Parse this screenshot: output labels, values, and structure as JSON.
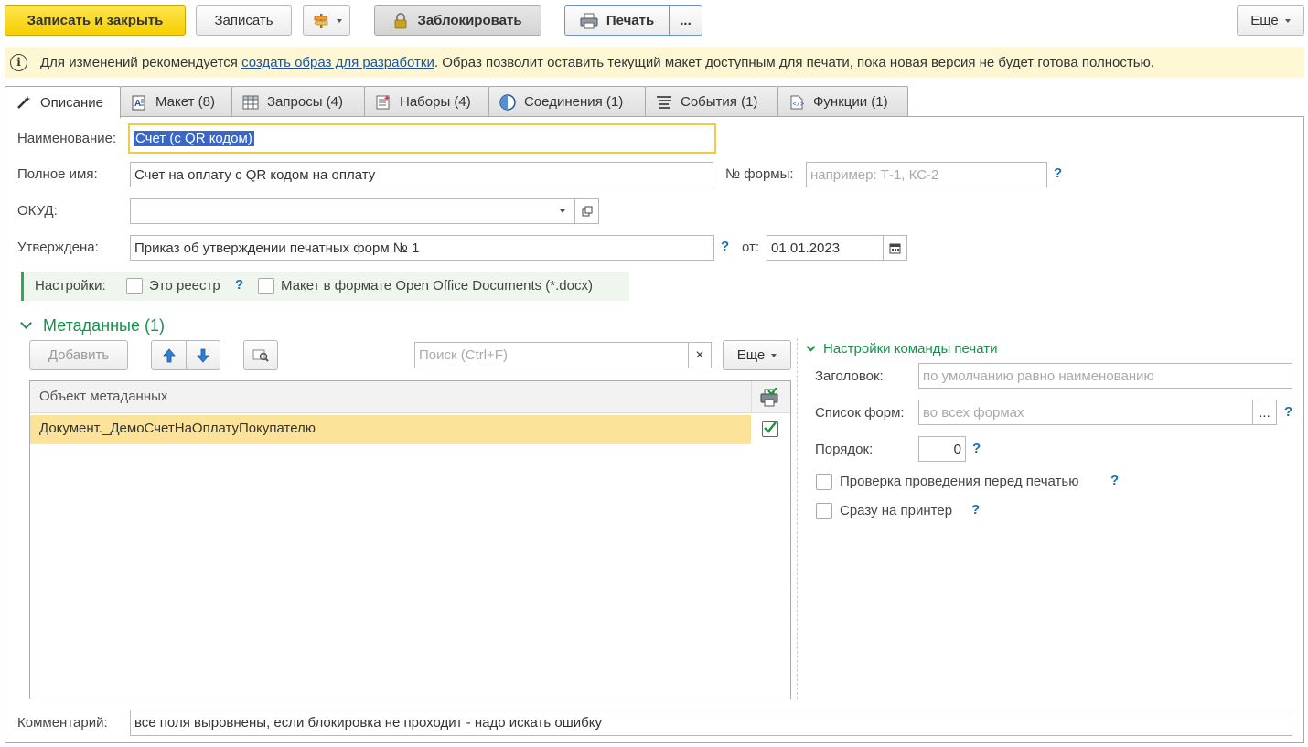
{
  "toolbar": {
    "save_close": "Записать и закрыть",
    "save": "Записать",
    "lock": "Заблокировать",
    "print": "Печать",
    "print_more": "...",
    "more": "Еще"
  },
  "info": {
    "text_before": "Для изменений рекомендуется",
    "link": "создать образ для разработки",
    "text_after": ". Образ позволит оставить текущий макет доступным для печати, пока новая версия не будет готова полностью."
  },
  "tabs": [
    {
      "label": "Описание",
      "icon": "wand-icon"
    },
    {
      "label": "Макет (8)",
      "icon": "layout-icon"
    },
    {
      "label": "Запросы (4)",
      "icon": "table-icon"
    },
    {
      "label": "Наборы (4)",
      "icon": "sets-icon"
    },
    {
      "label": "Соединения (1)",
      "icon": "join-icon"
    },
    {
      "label": "События (1)",
      "icon": "events-icon"
    },
    {
      "label": "Функции (1)",
      "icon": "functions-icon"
    }
  ],
  "form": {
    "name_label": "Наименование:",
    "name_value": "Счет (с QR кодом)",
    "fullname_label": "Полное имя:",
    "fullname_value": "Счет на оплату с QR кодом на оплату",
    "formno_label": "№ формы:",
    "formno_placeholder": "например: Т-1, КС-2",
    "okud_label": "ОКУД:",
    "okud_value": "",
    "approved_label": "Утверждена:",
    "approved_value": "Приказ об утверждении печатных форм № 1",
    "from_label": "от:",
    "date_value": "01.01.2023",
    "settings_label": "Настройки:",
    "registry_label": "Это реестр",
    "docx_label": "Макет в формате Open Office Documents (*.docx)",
    "help": "?"
  },
  "metadata": {
    "title": "Метаданные (1)",
    "add": "Добавить",
    "search_placeholder": "Поиск (Ctrl+F)",
    "clear": "×",
    "more": "Еще",
    "column": "Объект метаданных",
    "rows": [
      {
        "object": "Документ._ДемоСчетНаОплатуПокупателю",
        "checked": true
      }
    ]
  },
  "print_settings": {
    "title": "Настройки команды печати",
    "header_label": "Заголовок:",
    "header_placeholder": "по умолчанию равно наименованию",
    "forms_label": "Список форм:",
    "forms_placeholder": "во всех формах",
    "forms_btn": "...",
    "order_label": "Порядок:",
    "order_value": "0",
    "check_posting": "Проверка проведения перед печатью",
    "direct_printer": "Сразу на принтер"
  },
  "comment": {
    "label": "Комментарий:",
    "value": "все поля выровнены, если блокировка не проходит - надо искать ошибку"
  },
  "colors": {
    "primary": "#f5cf00",
    "selection": "#fbe49a",
    "accent_green": "#13934a",
    "link": "#1a55a6"
  }
}
